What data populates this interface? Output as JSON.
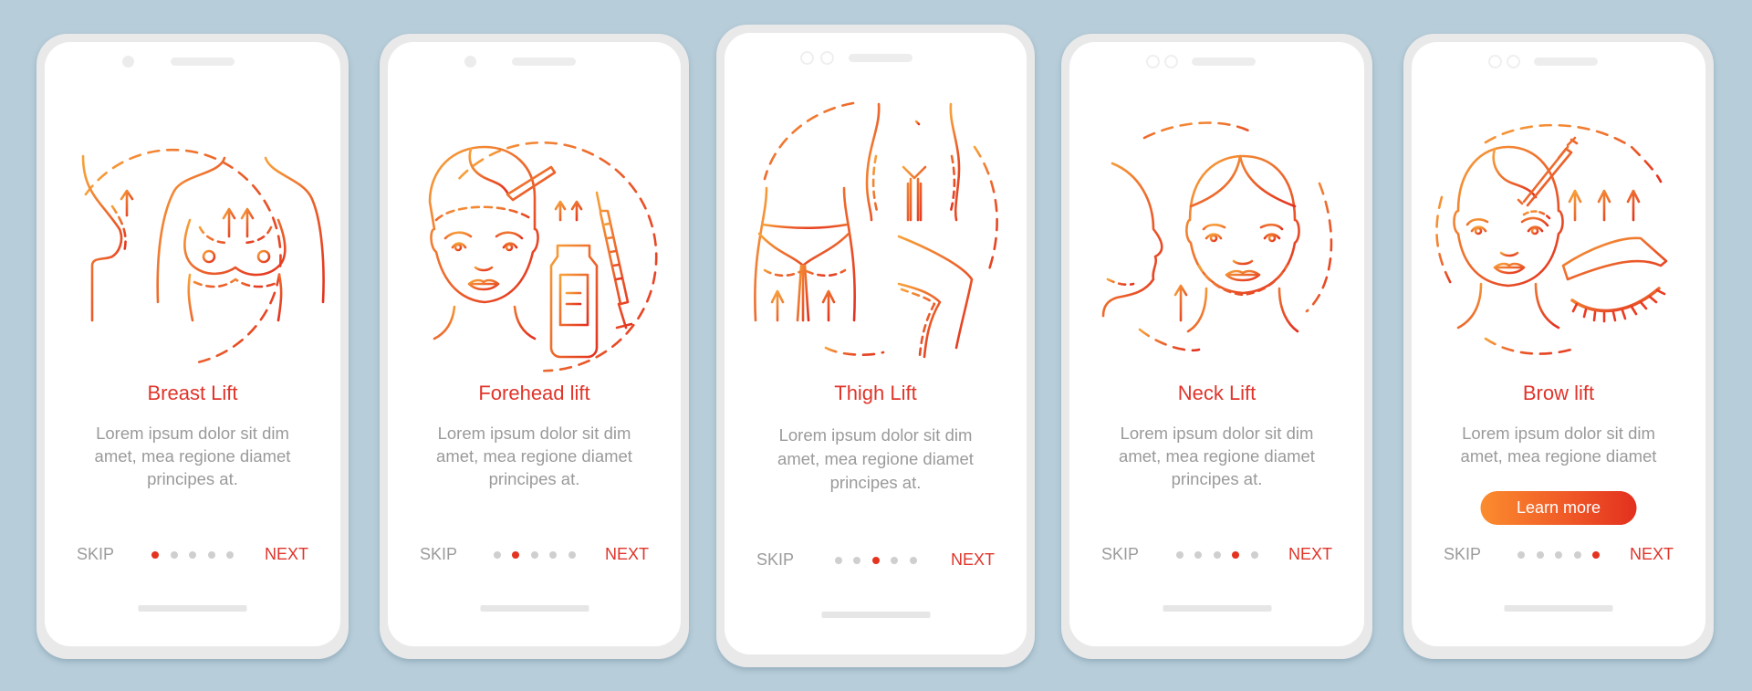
{
  "theme": {
    "accent": "#e0342a",
    "gradient_start": "#f7a23a",
    "gradient_end": "#e3301f",
    "background": "#b7cdd9",
    "dot_inactive": "#cfcfcf"
  },
  "screens": [
    {
      "illustration": "breast-lift-icon",
      "title": "Breast Lift",
      "body_lines": [
        "Lorem ipsum dolor sit dim",
        "amet, mea regione diamet",
        "principes at."
      ],
      "skip_label": "SKIP",
      "next_label": "NEXT",
      "page_index": 1,
      "page_count": 5
    },
    {
      "illustration": "forehead-lift-icon",
      "title": "Forehead lift",
      "body_lines": [
        "Lorem ipsum dolor sit dim",
        "amet, mea regione diamet",
        "principes at."
      ],
      "skip_label": "SKIP",
      "next_label": "NEXT",
      "page_index": 2,
      "page_count": 5
    },
    {
      "illustration": "thigh-lift-icon",
      "title": "Thigh Lift",
      "body_lines": [
        "Lorem ipsum dolor sit dim",
        "amet, mea regione diamet",
        "principes at."
      ],
      "skip_label": "SKIP",
      "next_label": "NEXT",
      "page_index": 3,
      "page_count": 5
    },
    {
      "illustration": "neck-lift-icon",
      "title": "Neck Lift",
      "body_lines": [
        "Lorem ipsum dolor sit dim",
        "amet, mea regione diamet",
        "principes at."
      ],
      "skip_label": "SKIP",
      "next_label": "NEXT",
      "page_index": 4,
      "page_count": 5
    },
    {
      "illustration": "brow-lift-icon",
      "title": "Brow lift",
      "body_lines": [
        "Lorem ipsum dolor sit dim",
        "amet, mea regione diamet"
      ],
      "cta_label": "Learn more",
      "skip_label": "SKIP",
      "next_label": "NEXT",
      "page_index": 5,
      "page_count": 5
    }
  ]
}
